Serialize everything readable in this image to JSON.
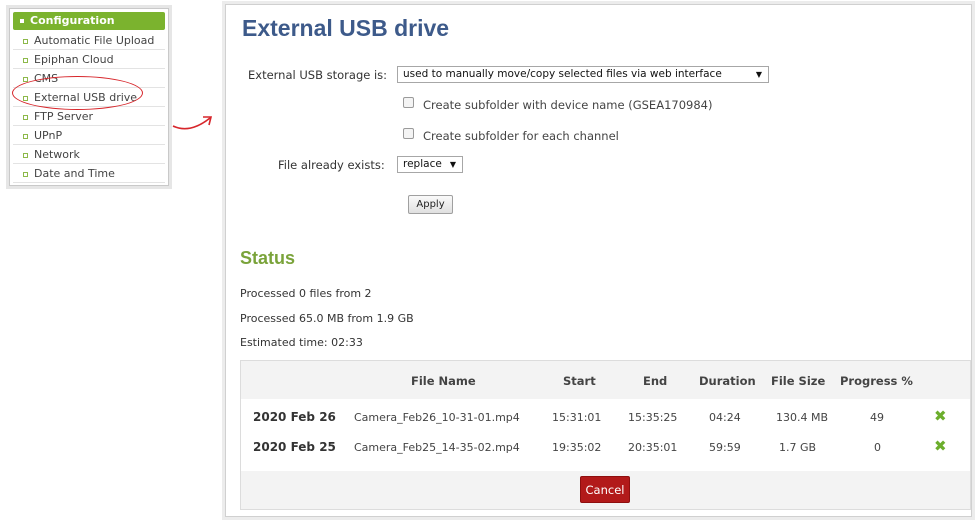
{
  "sidebar": {
    "header": "Configuration",
    "items": [
      {
        "label": "Automatic File Upload"
      },
      {
        "label": "Epiphan Cloud"
      },
      {
        "label": "CMS"
      },
      {
        "label": "External USB drive"
      },
      {
        "label": "FTP Server"
      },
      {
        "label": "UPnP"
      },
      {
        "label": "Network"
      },
      {
        "label": "Date and Time"
      }
    ]
  },
  "page": {
    "title": "External USB drive"
  },
  "form": {
    "storage_label": "External USB storage is:",
    "storage_value": "used to manually move/copy selected files via web interface",
    "subfolder_device_label": "Create subfolder with device name (GSEA170984)",
    "subfolder_channel_label": "Create subfolder for each channel",
    "file_exists_label": "File already exists:",
    "file_exists_value": "replace",
    "apply_label": "Apply"
  },
  "status": {
    "title": "Status",
    "processed_files": "Processed 0 files from 2",
    "processed_size": "Processed 65.0 MB from 1.9 GB",
    "estimated_time": "Estimated time: 02:33"
  },
  "table": {
    "headers": {
      "file_name": "File Name",
      "start": "Start",
      "end": "End",
      "duration": "Duration",
      "file_size": "File Size",
      "progress": "Progress %"
    },
    "rows": [
      {
        "date": "2020 Feb 26",
        "file": "Camera_Feb26_10-31-01.mp4",
        "start": "15:31:01",
        "end": "15:35:25",
        "duration": "04:24",
        "size": "130.4 MB",
        "progress": "49"
      },
      {
        "date": "2020 Feb 25",
        "file": "Camera_Feb25_14-35-02.mp4",
        "start": "19:35:02",
        "end": "20:35:01",
        "duration": "59:59",
        "size": "1.7 GB",
        "progress": "0"
      }
    ],
    "cancel_label": "Cancel"
  },
  "colors": {
    "brand_green": "#7bb32e",
    "title_blue": "#3d5a8a",
    "cancel_red": "#b21a1a",
    "annotation_red": "#d7262b"
  }
}
